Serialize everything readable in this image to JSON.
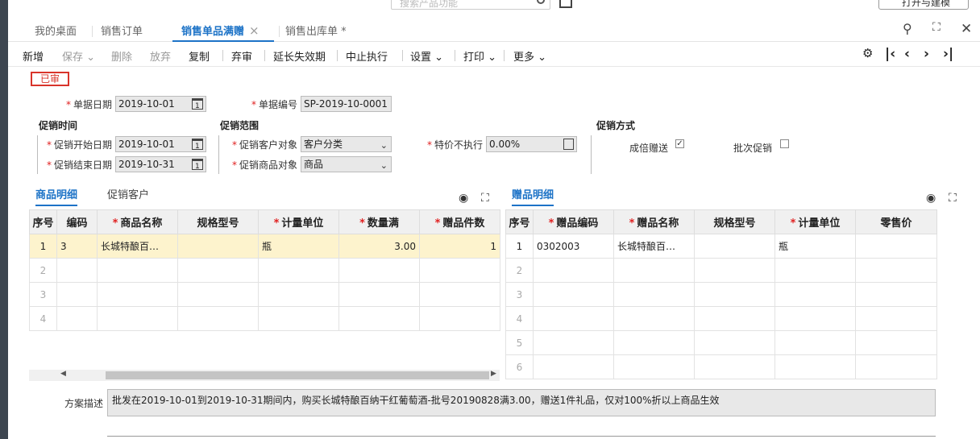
{
  "header": {
    "search_placeholder": "搜索产品功能",
    "right_button": "打开与建模"
  },
  "tabs": [
    {
      "label": "我的桌面"
    },
    {
      "label": "销售订单"
    },
    {
      "label": "销售单品满赠",
      "close": "×"
    },
    {
      "label": "销售出库单 *"
    }
  ],
  "toolbar": {
    "new": "新增",
    "save": "保存",
    "delete": "删除",
    "discard": "放弃",
    "copy": "复制",
    "unaudit": "弃审",
    "extend": "延长失效期",
    "stop": "中止执行",
    "settings": "设置",
    "print": "打印",
    "more": "更多"
  },
  "status": "已审",
  "form": {
    "doc_date_label": "单据日期",
    "doc_date": "2019-10-01",
    "doc_no_label": "单据编号",
    "doc_no": "SP-2019-10-0001",
    "group_time": "促销时间",
    "group_scope": "促销范围",
    "group_method": "促销方式",
    "start_label": "促销开始日期",
    "start": "2019-10-01",
    "end_label": "促销结束日期",
    "end": "2019-10-31",
    "cust_obj_label": "促销客户对象",
    "cust_obj": "客户分类",
    "goods_obj_label": "促销商品对象",
    "goods_obj": "商品",
    "special_label": "特价不执行",
    "special": "0.00%",
    "multiple_label": "成倍赠送",
    "multiple_checked": true,
    "batch_label": "批次促销",
    "batch_checked": false
  },
  "left_tabs": {
    "goods": "商品明细",
    "customers": "促销客户"
  },
  "right_tabs": {
    "gifts": "赠品明细"
  },
  "left_table": {
    "headers": [
      "序号",
      "编码",
      "商品名称",
      "规格型号",
      "计量单位",
      "数量满",
      "赠品件数"
    ],
    "rows": [
      [
        "1",
        "3",
        "长城特酿百…",
        "",
        "瓶",
        "3.00",
        "1"
      ],
      [
        "2",
        "",
        "",
        "",
        "",
        "",
        ""
      ],
      [
        "3",
        "",
        "",
        "",
        "",
        "",
        ""
      ],
      [
        "4",
        "",
        "",
        "",
        "",
        "",
        ""
      ]
    ]
  },
  "right_table": {
    "headers": [
      "序号",
      "赠品编码",
      "赠品名称",
      "规格型号",
      "计量单位",
      "零售价"
    ],
    "rows": [
      [
        "1",
        "0302003",
        "长城特酿百…",
        "",
        "瓶",
        ""
      ],
      [
        "2",
        "",
        "",
        "",
        "",
        ""
      ],
      [
        "3",
        "",
        "",
        "",
        "",
        ""
      ],
      [
        "4",
        "",
        "",
        "",
        "",
        ""
      ],
      [
        "5",
        "",
        "",
        "",
        "",
        ""
      ],
      [
        "6",
        "",
        "",
        "",
        "",
        ""
      ]
    ]
  },
  "description": {
    "label": "方案描述",
    "text": "批发在2019-10-01到2019-10-31期间内，购买长城特酿百纳干红葡萄酒-批号20190828满3.00，赠送1件礼品，仅对100%折以上商品生效"
  }
}
